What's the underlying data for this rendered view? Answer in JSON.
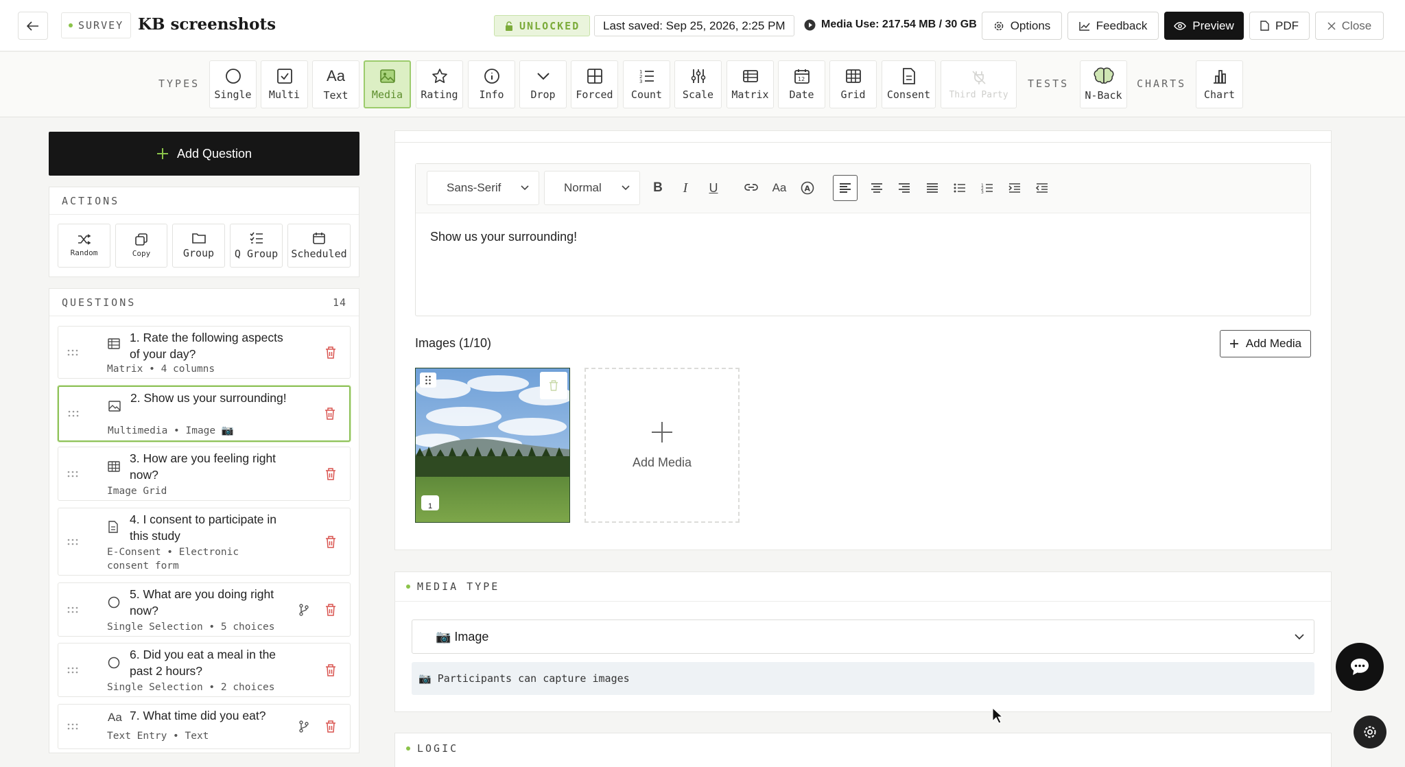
{
  "header": {
    "survey_tag": "SURVEY",
    "title": "KB screenshots",
    "status": "UNLOCKED",
    "last_saved": "Last saved: Sep 25, 2026, 2:25 PM",
    "media_use": "Media Use: 217.54 MB / 30 GB",
    "buttons": {
      "options": "Options",
      "feedback": "Feedback",
      "preview": "Preview",
      "pdf": "PDF",
      "close": "Close"
    }
  },
  "types_bar": {
    "types_label": "TYPES",
    "tests_label": "TESTS",
    "charts_label": "CHARTS",
    "types": [
      {
        "label": "Single",
        "icon": "circle-icon"
      },
      {
        "label": "Multi",
        "icon": "checkbox-icon"
      },
      {
        "label": "Text",
        "icon": "text-aa-icon"
      },
      {
        "label": "Media",
        "icon": "image-icon",
        "active": true
      },
      {
        "label": "Rating",
        "icon": "star-icon"
      },
      {
        "label": "Info",
        "icon": "info-icon"
      },
      {
        "label": "Drop",
        "icon": "chevron-down-icon"
      },
      {
        "label": "Forced",
        "icon": "grid-icon"
      },
      {
        "label": "Count",
        "icon": "numbered-list-icon"
      },
      {
        "label": "Scale",
        "icon": "sliders-icon"
      },
      {
        "label": "Matrix",
        "icon": "matrix-icon"
      },
      {
        "label": "Date",
        "icon": "calendar-icon"
      },
      {
        "label": "Grid",
        "icon": "table-icon"
      },
      {
        "label": "Consent",
        "icon": "document-icon"
      },
      {
        "label": "Third Party",
        "icon": "plug-icon",
        "disabled": true
      }
    ],
    "tests": [
      {
        "label": "N-Back",
        "icon": "brain-icon"
      }
    ],
    "charts": [
      {
        "label": "Chart",
        "icon": "bar-chart-icon"
      }
    ]
  },
  "sidebar": {
    "add_question": "Add Question",
    "actions_label": "ACTIONS",
    "actions": [
      {
        "label": "Random",
        "icon": "shuffle-icon"
      },
      {
        "label": "Copy",
        "icon": "copy-icon"
      },
      {
        "label": "Group",
        "icon": "folder-icon"
      },
      {
        "label": "Q Group",
        "icon": "checklist-icon"
      },
      {
        "label": "Scheduled",
        "icon": "calendar-icon"
      }
    ],
    "questions_label": "QUESTIONS",
    "questions_count": "14",
    "questions": [
      {
        "title": "1. Rate the following aspects of your day?",
        "subtitle": "Matrix • 4 columns"
      },
      {
        "title": "2. Show us your surrounding!",
        "subtitle": "Multimedia • Image 📷"
      },
      {
        "title": "3. How are you feeling right now?",
        "subtitle": "Image Grid"
      },
      {
        "title": "4. I consent to participate in this study",
        "subtitle": "E-Consent • Electronic consent form"
      },
      {
        "title": "5. What are you doing right now?",
        "subtitle": "Single Selection • 5 choices"
      },
      {
        "title": "6. Did you eat a meal in the past 2 hours?",
        "subtitle": "Single Selection • 2 choices"
      },
      {
        "title": "7. What time did you eat?",
        "subtitle": "Text Entry • Text"
      }
    ]
  },
  "editor": {
    "font_family": "Sans-Serif",
    "font_size": "Normal",
    "content": "Show us your surrounding!"
  },
  "images": {
    "label": "Images (1/10)",
    "add_media_button": "Add Media",
    "tile_label": "Add Media",
    "thumb_index": "1"
  },
  "media_type": {
    "section_label": "MEDIA TYPE",
    "selected": "📷 Image",
    "info": "📷 Participants can capture images"
  },
  "logic": {
    "section_label": "LOGIC"
  },
  "colors": {
    "accent": "#8bc34a",
    "dark": "#141414"
  }
}
